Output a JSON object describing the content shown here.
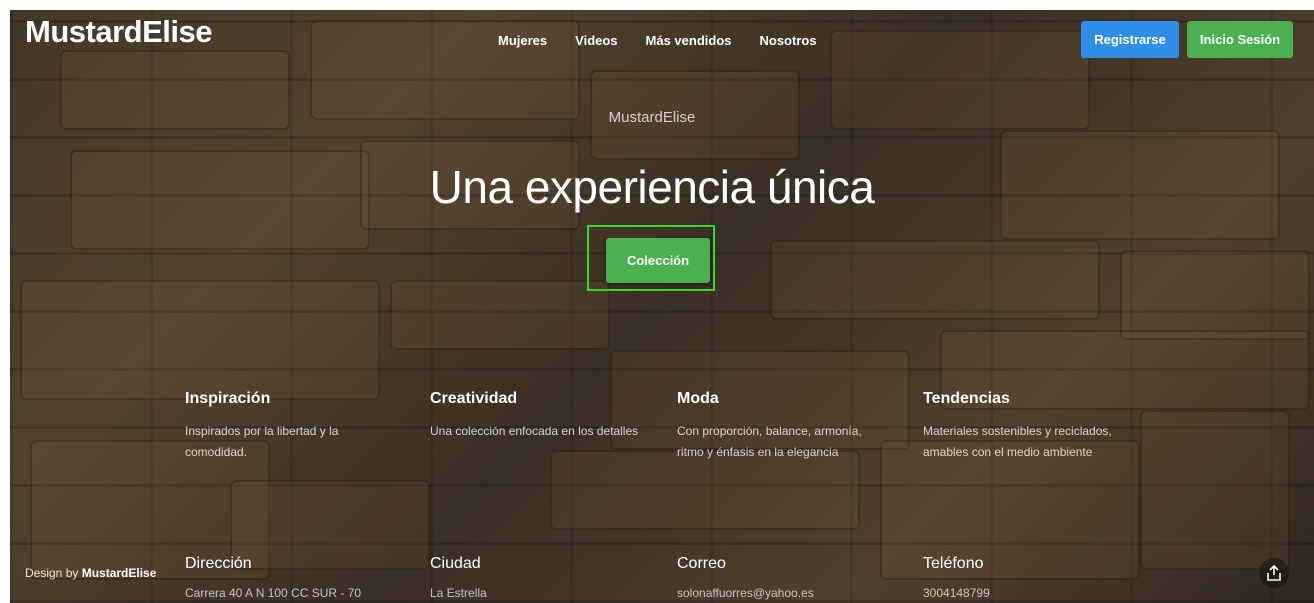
{
  "brand": "MustardElise",
  "nav": [
    "Mujeres",
    "Videos",
    "Más vendidos",
    "Nosotros"
  ],
  "buttons": {
    "register": "Registrarse",
    "login": "Inicio Sesión",
    "collection": "Colección"
  },
  "hero": {
    "eyebrow": "MustardElise",
    "title": "Una experiencia única"
  },
  "features": [
    {
      "title": "Inspiración",
      "text": "Inspirados por la libertad y la comodidad."
    },
    {
      "title": "Creatividad",
      "text": "Una colección enfocada en los detalles"
    },
    {
      "title": "Moda",
      "text": "Con proporción, balance, armonía, ritmo y énfasis en la elegancia"
    },
    {
      "title": "Tendencias",
      "text": "Materiales sostenibles y reciclados, amables con el medio ambiente"
    }
  ],
  "info": [
    {
      "label": "Dirección",
      "value": "Carrera 40 A N 100 CC SUR - 70"
    },
    {
      "label": "Ciudad",
      "value": "La Estrella"
    },
    {
      "label": "Correo",
      "value": "solonaffuorres@yahoo.es"
    },
    {
      "label": "Teléfono",
      "value": "3004148799"
    }
  ],
  "footer": {
    "design_prefix": "Design by",
    "design_brand": "MustardElise"
  },
  "icons": {
    "share": "share-icon"
  },
  "colors": {
    "primary": "#2f8ee6",
    "success": "#4caf50",
    "highlight": "#36d82d"
  }
}
